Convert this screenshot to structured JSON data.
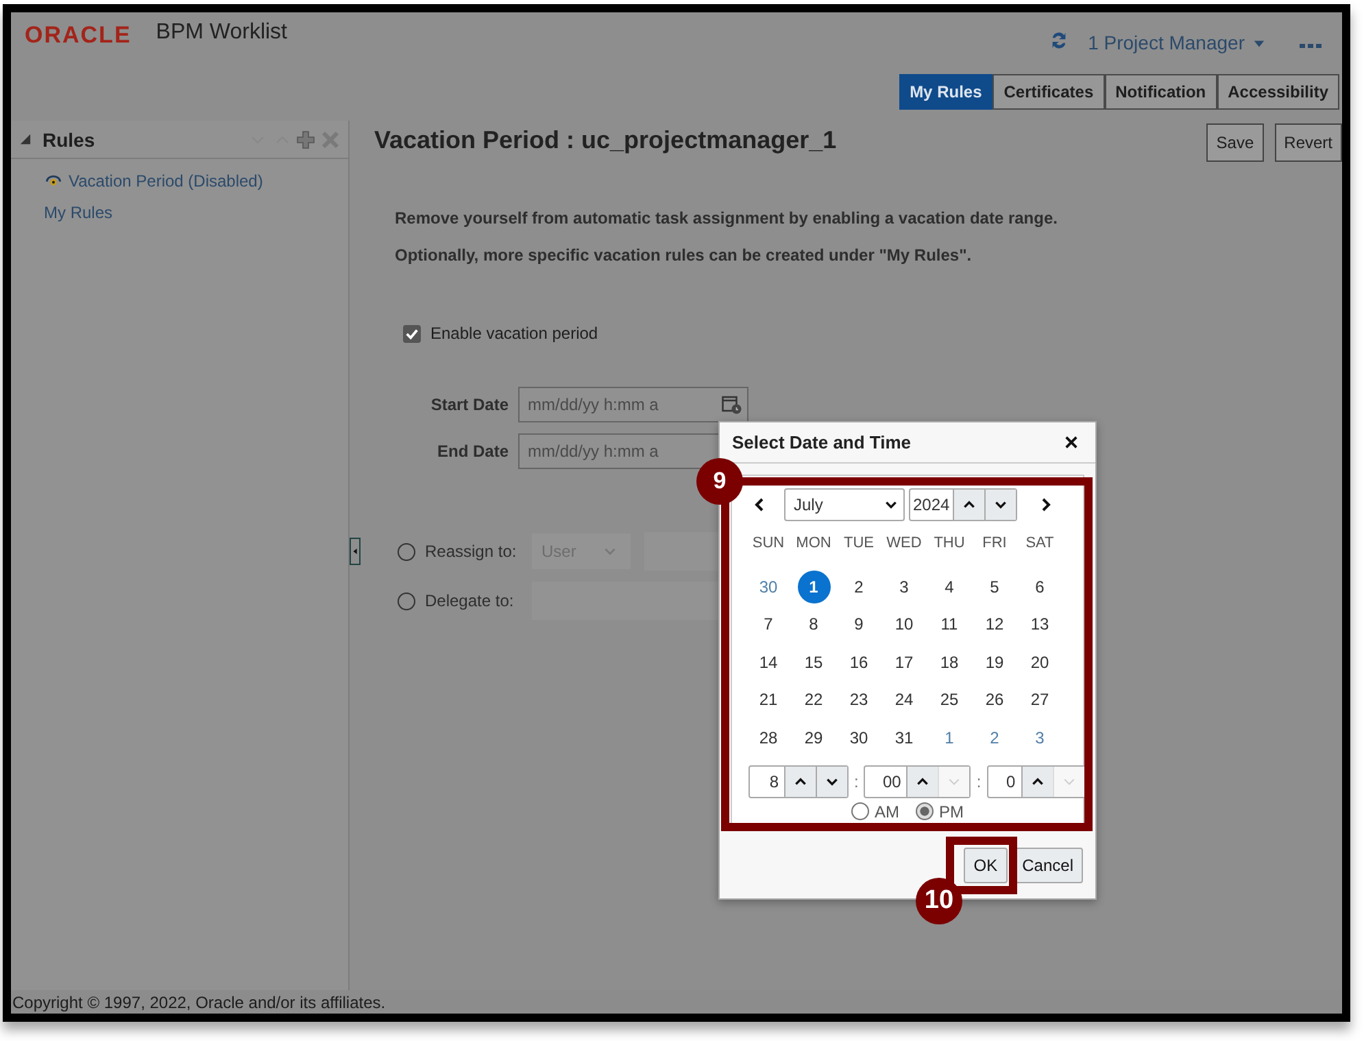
{
  "header": {
    "logo": "ORACLE",
    "app_title": "BPM Worklist",
    "user": "1 Project Manager"
  },
  "tabs": [
    {
      "label": "My Rules",
      "selected": true
    },
    {
      "label": "Certificates",
      "selected": false
    },
    {
      "label": "Notification",
      "selected": false
    },
    {
      "label": "Accessibility",
      "selected": false
    }
  ],
  "sidebar": {
    "title": "Rules",
    "items": [
      {
        "label": "Vacation Period (Disabled)",
        "kind": "vacation"
      },
      {
        "label": "My Rules",
        "kind": "plain"
      }
    ]
  },
  "main": {
    "title": "Vacation Period : uc_projectmanager_1",
    "buttons": [
      "Save",
      "Revert"
    ],
    "intro": [
      "Remove yourself from automatic task assignment by enabling a vacation date range.",
      "Optionally, more specific vacation rules can be created under \"My Rules\"."
    ],
    "enable": {
      "label": "Enable vacation period",
      "checked": true
    },
    "dates": [
      {
        "label": "Start Date",
        "placeholder": "mm/dd/yy h:mm a"
      },
      {
        "label": "End Date",
        "placeholder": "mm/dd/yy h:mm a"
      }
    ],
    "reassign": {
      "label": "Reassign to:",
      "selected": false,
      "type": "User"
    },
    "delegate": {
      "label": "Delegate to:",
      "selected": false
    }
  },
  "dialog": {
    "title": "Select Date and Time",
    "month": "July",
    "year": "2024",
    "weekdays": [
      "SUN",
      "MON",
      "TUE",
      "WED",
      "THU",
      "FRI",
      "SAT"
    ],
    "weeks": [
      [
        {
          "day": "30",
          "other_month": true,
          "selected": false
        },
        {
          "day": "1",
          "other_month": false,
          "selected": true
        },
        {
          "day": "2",
          "other_month": false,
          "selected": false
        },
        {
          "day": "3",
          "other_month": false,
          "selected": false
        },
        {
          "day": "4",
          "other_month": false,
          "selected": false
        },
        {
          "day": "5",
          "other_month": false,
          "selected": false
        },
        {
          "day": "6",
          "other_month": false,
          "selected": false
        }
      ],
      [
        {
          "day": "7",
          "other_month": false,
          "selected": false
        },
        {
          "day": "8",
          "other_month": false,
          "selected": false
        },
        {
          "day": "9",
          "other_month": false,
          "selected": false
        },
        {
          "day": "10",
          "other_month": false,
          "selected": false
        },
        {
          "day": "11",
          "other_month": false,
          "selected": false
        },
        {
          "day": "12",
          "other_month": false,
          "selected": false
        },
        {
          "day": "13",
          "other_month": false,
          "selected": false
        }
      ],
      [
        {
          "day": "14",
          "other_month": false,
          "selected": false
        },
        {
          "day": "15",
          "other_month": false,
          "selected": false
        },
        {
          "day": "16",
          "other_month": false,
          "selected": false
        },
        {
          "day": "17",
          "other_month": false,
          "selected": false
        },
        {
          "day": "18",
          "other_month": false,
          "selected": false
        },
        {
          "day": "19",
          "other_month": false,
          "selected": false
        },
        {
          "day": "20",
          "other_month": false,
          "selected": false
        }
      ],
      [
        {
          "day": "21",
          "other_month": false,
          "selected": false
        },
        {
          "day": "22",
          "other_month": false,
          "selected": false
        },
        {
          "day": "23",
          "other_month": false,
          "selected": false
        },
        {
          "day": "24",
          "other_month": false,
          "selected": false
        },
        {
          "day": "25",
          "other_month": false,
          "selected": false
        },
        {
          "day": "26",
          "other_month": false,
          "selected": false
        },
        {
          "day": "27",
          "other_month": false,
          "selected": false
        }
      ],
      [
        {
          "day": "28",
          "other_month": false,
          "selected": false
        },
        {
          "day": "29",
          "other_month": false,
          "selected": false
        },
        {
          "day": "30",
          "other_month": false,
          "selected": false
        },
        {
          "day": "31",
          "other_month": false,
          "selected": false
        },
        {
          "day": "1",
          "other_month": true,
          "selected": false
        },
        {
          "day": "2",
          "other_month": true,
          "selected": false
        },
        {
          "day": "3",
          "other_month": true,
          "selected": false
        }
      ]
    ],
    "time": [
      {
        "value": "8",
        "down_disabled": false
      },
      {
        "separator": ":",
        "value": "00",
        "down_disabled": true
      },
      {
        "separator": ":",
        "value": "0",
        "down_disabled": true
      }
    ],
    "ampm": [
      {
        "label": "AM",
        "selected": false
      },
      {
        "label": "PM",
        "selected": true
      }
    ],
    "buttons": [
      "OK",
      "Cancel"
    ]
  },
  "annotations": [
    {
      "number": "9"
    },
    {
      "number": "10"
    }
  ],
  "footer": "Copyright © 1997, 2022, Oracle and/or its affiliates."
}
